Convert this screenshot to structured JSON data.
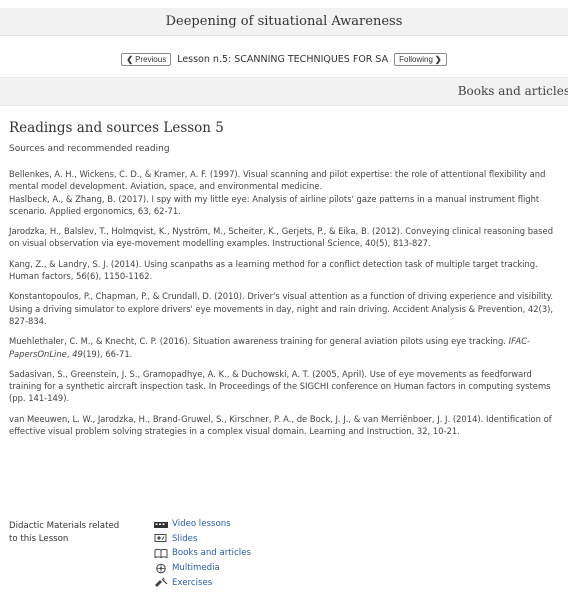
{
  "course": {
    "title": "Deepening of situational Awareness"
  },
  "nav": {
    "previous_label": "Previous",
    "lesson_label": "Lesson n.5: SCANNING TECHNIQUES FOR SA",
    "following_label": "Following"
  },
  "section": {
    "label": "Books and articles"
  },
  "page": {
    "title": "Readings and sources Lesson 5",
    "subtitle": "Sources and recommended reading"
  },
  "references": [
    "Bellenkes, A. H., Wickens, C. D., & Kramer, A. F. (1997). Visual scanning and pilot expertise: the role of attentional flexibility and mental model development. Aviation, space, and environmental medicine.",
    "Haslbeck, A., & Zhang, B. (2017). I spy with my little eye: Analysis of airline pilots' gaze patterns in a manual instrument flight scenario. Applied ergonomics, 63, 62-71.",
    "Jarodzka, H., Balslev, T., Holmqvist, K., Nyström, M., Scheiter, K., Gerjets, P., & Eika, B. (2012). Conveying clinical reasoning based on visual observation via eye-movement modelling examples. Instructional Science, 40(5), 813-827.",
    "Kang, Z., & Landry, S. J. (2014). Using scanpaths as a learning method for a conflict detection task of multiple target tracking. Human factors, 56(6), 1150-1162.",
    "Konstantopoulos, P., Chapman, P., & Crundall, D. (2010). Driver's visual attention as a function of driving experience and visibility. Using a driving simulator to explore drivers' eye movements in day, night and rain driving. Accident Analysis & Prevention, 42(3), 827-834.",
    {
      "before": "Muehlethaler, C. M., & Knecht, C. P. (2016). Situation awareness training for general aviation pilots using eye tracking. ",
      "journal": "IFAC-PapersOnLine",
      "sep": ", ",
      "volume": "49",
      "after": "(19), 66-71."
    },
    "Sadasivan, S., Greenstein, J. S., Gramopadhye, A. K., & Duchowski, A. T. (2005, April). Use of eye movements as feedforward training for a synthetic aircraft inspection task. In Proceedings of the SIGCHI conference on Human factors in computing systems (pp. 141-149).",
    "van Meeuwen, L. W., Jarodzka, H., Brand-Gruwel, S., Kirschner, P. A., de Bock, J. J., & van Merriënboer, J. J. (2014). Identification of effective visual problem solving strategies in a complex visual domain. Learning and Instruction, 32, 10-21."
  ],
  "materials": {
    "label": "Didactic Materials related to this Lesson",
    "items": [
      {
        "label": "Video lessons",
        "icon": "video-icon"
      },
      {
        "label": "Slides",
        "icon": "slides-icon"
      },
      {
        "label": "Books and articles",
        "icon": "book-icon"
      },
      {
        "label": "Multimedia",
        "icon": "multimedia-icon"
      },
      {
        "label": "Exercises",
        "icon": "exercises-icon"
      }
    ]
  },
  "colors": {
    "link": "#2a5db0",
    "bar": "#f2f2f2",
    "text": "#333333"
  }
}
